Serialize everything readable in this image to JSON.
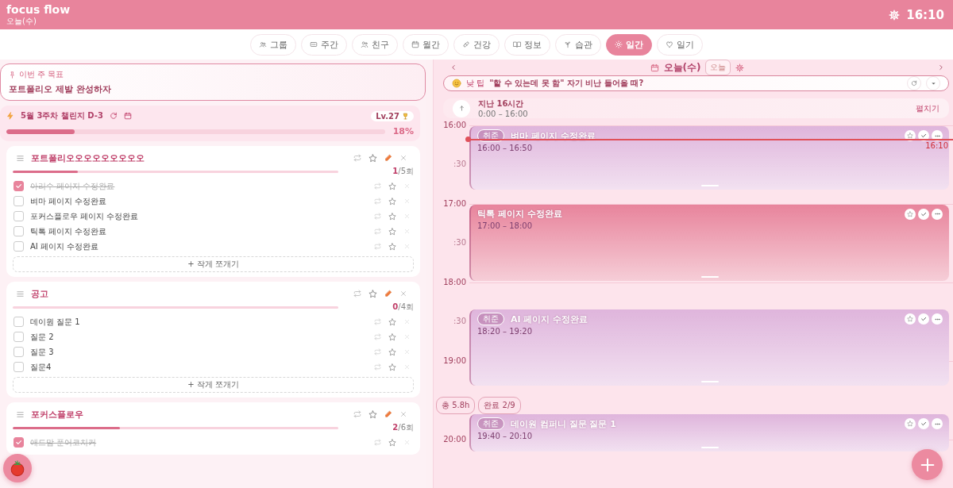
{
  "header": {
    "title": "focus flow",
    "subtitle": "오늘(수)",
    "clock": "16:10"
  },
  "tabs": [
    {
      "label": "그룹",
      "selected": false
    },
    {
      "label": "주간",
      "selected": false
    },
    {
      "label": "친구",
      "selected": false
    },
    {
      "label": "월간",
      "selected": false
    },
    {
      "label": "건강",
      "selected": false
    },
    {
      "label": "정보",
      "selected": false
    },
    {
      "label": "습관",
      "selected": false
    },
    {
      "label": "일간",
      "selected": true
    },
    {
      "label": "일기",
      "selected": false
    }
  ],
  "weekly_goal": {
    "label": "이번 주 목표",
    "text": "포트폴리오 제발 완성하자"
  },
  "challenge": {
    "title": "5월 3주차 챌린지 D-3",
    "level_badge": "Lv.27",
    "level": 0.18,
    "percent": "18%"
  },
  "groups": [
    {
      "title": "포트폴리오오오오오오오오오",
      "level": 0.2,
      "count": "**1**/5회",
      "add_button": "+ 작게 쪼개기",
      "items": [
        {
          "text": "아리수 페이지 수정완료",
          "checked": true
        },
        {
          "text": "벼마 페이지 수정완료",
          "checked": false
        },
        {
          "text": "포커스플로우 페이지 수정완료",
          "checked": false
        },
        {
          "text": "틱톡 페이지 수정완료",
          "checked": false
        },
        {
          "text": "AI 페이지 수정완료",
          "checked": false
        }
      ]
    },
    {
      "title": "공고",
      "level": 0,
      "count": "**0**/4회",
      "add_button": "+ 작게 쪼개기",
      "items": [
        {
          "text": "데이원 질문 1",
          "checked": false
        },
        {
          "text": "질문 2",
          "checked": false
        },
        {
          "text": "질문 3",
          "checked": false
        },
        {
          "text": "질문4",
          "checked": false
        }
      ]
    },
    {
      "title": "포커스플로우",
      "level": 0.33,
      "count": "**2**/6회",
      "items": [
        {
          "text": "애드맘 푼어코치커",
          "checked": true
        }
      ]
    }
  ],
  "day": {
    "title": "오늘(수)",
    "today_button": "오늘",
    "tip": {
      "label": "낮 팁",
      "text": "\"할 수 있는데 못 함\" 자기 비난 들어올 때?"
    },
    "past": {
      "title": "지난 16시간",
      "range": "0:00 – 16:00",
      "toggle": "펼치기"
    },
    "timeline": {
      "now": "16:10",
      "hours": [
        {
          "label": "16:00",
          "half": ":30"
        },
        {
          "label": "17:00",
          "half": ":30"
        },
        {
          "label": "18:00",
          "half": ":30"
        },
        {
          "label": "19:00"
        },
        {
          "label": "20:00"
        }
      ],
      "events": [
        {
          "tag": "취준",
          "title": "벼마 페이지 수정완료",
          "time": "16:00 – 16:50",
          "color": "#dfb5dc"
        },
        {
          "title": "틱톡 페이지 수정완료",
          "time": "17:00 – 18:00",
          "color": "#e8849c"
        },
        {
          "tag": "취준",
          "title": "AI 페이지 수정완료",
          "time": "18:20 – 19:20",
          "color": "#dfb5dc"
        },
        {
          "tag": "취준",
          "title": "데이원 컴퍼니 질문 질문 1",
          "time": "19:40 – 20:10",
          "color": "#dfb5dc"
        }
      ]
    },
    "summary": [
      "총 5.8h",
      "완료 2/9"
    ]
  }
}
